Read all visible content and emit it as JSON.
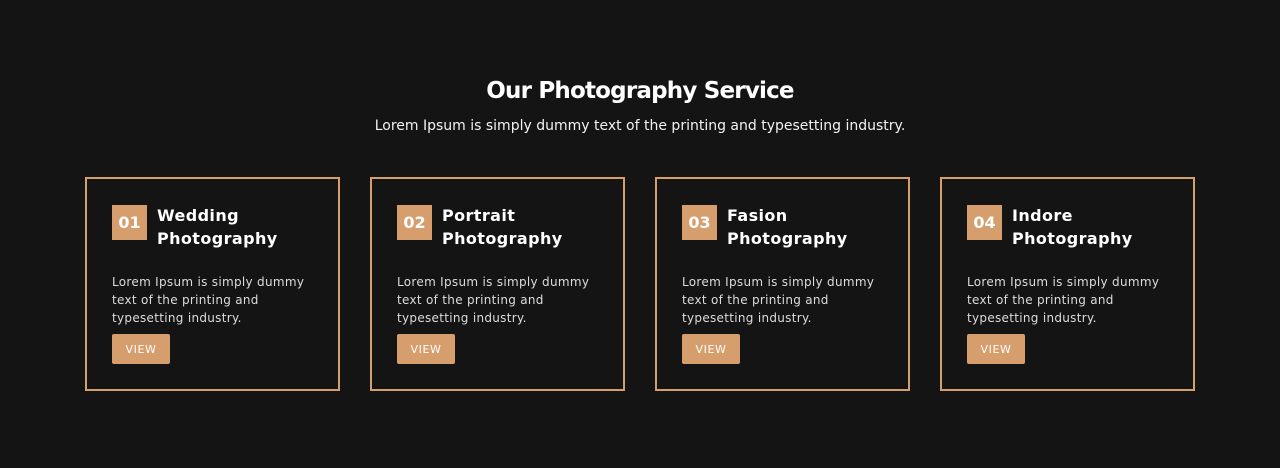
{
  "section": {
    "title": "Our Photography Service",
    "subtitle": "Lorem Ipsum is simply dummy text of the printing and typesetting industry."
  },
  "theme": {
    "background": "#141414",
    "accent": "#d69e6d",
    "text": "#ffffff"
  },
  "cards": [
    {
      "number": "01",
      "title_line1": "Wedding",
      "title_line2": "Photography",
      "text": "Lorem Ipsum is simply dummy text of the printing and typesetting industry.",
      "button_label": "VIEW"
    },
    {
      "number": "02",
      "title_line1": "Portrait",
      "title_line2": "Photography",
      "text": "Lorem Ipsum is simply dummy text of the printing and typesetting industry.",
      "button_label": "VIEW"
    },
    {
      "number": "03",
      "title_line1": "Fasion",
      "title_line2": "Photography",
      "text": "Lorem Ipsum is simply dummy text of the printing and typesetting industry.",
      "button_label": "VIEW"
    },
    {
      "number": "04",
      "title_line1": "Indore",
      "title_line2": "Photography",
      "text": "Lorem Ipsum is simply dummy text of the printing and typesetting industry.",
      "button_label": "VIEW"
    }
  ]
}
